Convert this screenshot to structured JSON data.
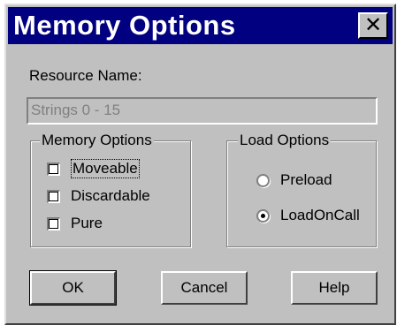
{
  "dialog": {
    "title": "Memory Options",
    "close_label": "✕",
    "resource_name_label": "Resource Name:",
    "resource_name_value": "Strings 0 - 15"
  },
  "memory_options": {
    "title": "Memory Options",
    "items": [
      {
        "label": "Moveable",
        "checked": false
      },
      {
        "label": "Discardable",
        "checked": false
      },
      {
        "label": "Pure",
        "checked": false
      }
    ]
  },
  "load_options": {
    "title": "Load Options",
    "items": [
      {
        "label": "Preload",
        "selected": false
      },
      {
        "label": "LoadOnCall",
        "selected": true
      }
    ]
  },
  "buttons": {
    "ok": "OK",
    "cancel": "Cancel",
    "help": "Help"
  },
  "colors": {
    "titlebar": "#000080",
    "face": "#c0c0c0"
  }
}
